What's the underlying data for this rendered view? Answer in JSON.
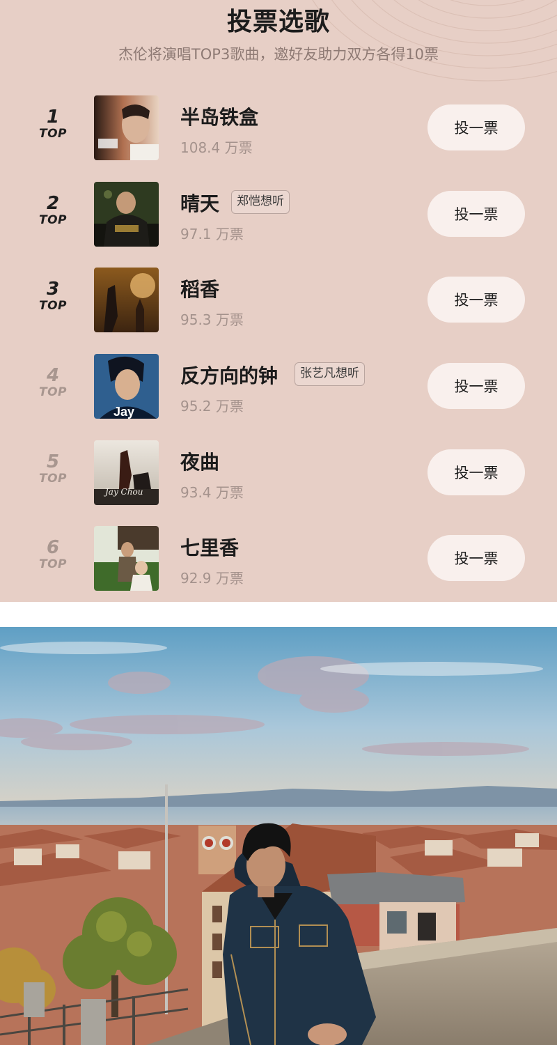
{
  "panel": {
    "title": "投票选歌",
    "subtitle": "杰伦将演唱TOP3歌曲，邀好友助力双方各得10票",
    "rank_suffix": "TOP",
    "vote_button_label": "投一票",
    "songs": [
      {
        "rank": "1",
        "name": "半岛铁盒",
        "votes": "108.4 万票",
        "tag": "",
        "cover_text": ""
      },
      {
        "rank": "2",
        "name": "晴天",
        "votes": "97.1 万票",
        "tag": "郑恺想听",
        "cover_text": ""
      },
      {
        "rank": "3",
        "name": "稻香",
        "votes": "95.3 万票",
        "tag": "",
        "cover_text": ""
      },
      {
        "rank": "4",
        "name": "反方向的钟",
        "votes": "95.2 万票",
        "tag": "张艺凡想听",
        "cover_text": "Jay"
      },
      {
        "rank": "5",
        "name": "夜曲",
        "votes": "93.4 万票",
        "tag": "",
        "cover_text": "Jay Chou"
      },
      {
        "rank": "6",
        "name": "七里香",
        "votes": "92.9 万票",
        "tag": "",
        "cover_text": ""
      }
    ]
  },
  "colors": {
    "panel_bg": "#e7cfc6",
    "button_bg": "#f9f0ed",
    "muted_text": "#a4928c"
  },
  "photo": {
    "subject": "man-in-denim-jacket-over-lakeside-rooftops"
  }
}
